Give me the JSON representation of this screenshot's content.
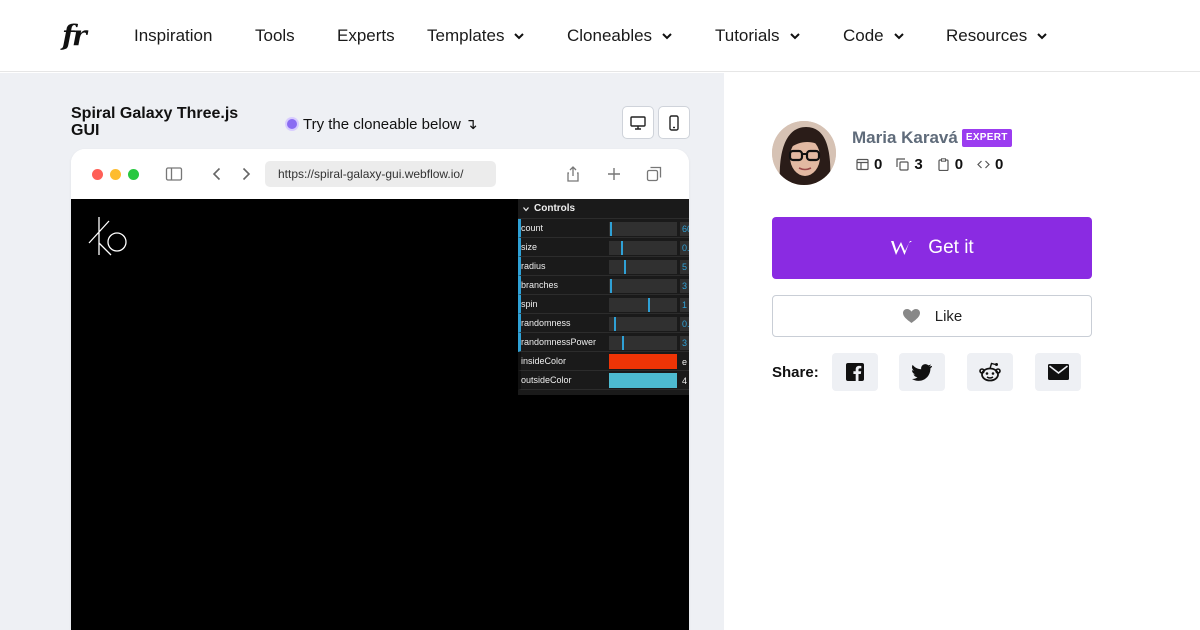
{
  "nav": {
    "logo": "fr",
    "items": [
      {
        "label": "Inspiration",
        "dropdown": false
      },
      {
        "label": "Tools",
        "dropdown": false
      },
      {
        "label": "Experts",
        "dropdown": false
      },
      {
        "label": "Templates",
        "dropdown": true
      },
      {
        "label": "Cloneables",
        "dropdown": true
      },
      {
        "label": "Tutorials",
        "dropdown": true
      },
      {
        "label": "Code",
        "dropdown": true
      },
      {
        "label": "Resources",
        "dropdown": true
      }
    ]
  },
  "project": {
    "title": "Spiral Galaxy Three.js GUI",
    "try_label": "Try the cloneable below ↴"
  },
  "browser": {
    "url": "https://spiral-galaxy-gui.webflow.io/"
  },
  "gui": {
    "header": "Controls",
    "rows": [
      {
        "label": "count",
        "value": "60",
        "level": 0.05
      },
      {
        "label": "size",
        "value": "0.",
        "level": 0.2
      },
      {
        "label": "radius",
        "value": "5",
        "level": 0.25
      },
      {
        "label": "branches",
        "value": "3",
        "level": 0.05
      },
      {
        "label": "spin",
        "value": "1",
        "level": 0.6
      },
      {
        "label": "randomness",
        "value": "0.",
        "level": 0.1
      },
      {
        "label": "randomnessPower",
        "value": "3",
        "level": 0.22
      }
    ],
    "colors": [
      {
        "label": "insideColor",
        "text": "e",
        "swatch": "#ee3406",
        "text_color": "#ffffff"
      },
      {
        "label": "outsideColor",
        "text": "4",
        "swatch": "#4dbbd1",
        "text_color": "#ffffff"
      }
    ]
  },
  "author": {
    "name": "Maria Karavá",
    "badge": "EXPERT",
    "stats": [
      {
        "icon": "template-icon",
        "value": "0"
      },
      {
        "icon": "clone-icon",
        "value": "3"
      },
      {
        "icon": "clipboard-icon",
        "value": "0"
      },
      {
        "icon": "code-icon",
        "value": "0"
      }
    ]
  },
  "actions": {
    "get_it": "Get it",
    "like": "Like",
    "share_label": "Share:"
  },
  "colors": {
    "accent": "#8a2be2",
    "badge": "#9b3cf0",
    "slider": "#2fa1d6"
  }
}
